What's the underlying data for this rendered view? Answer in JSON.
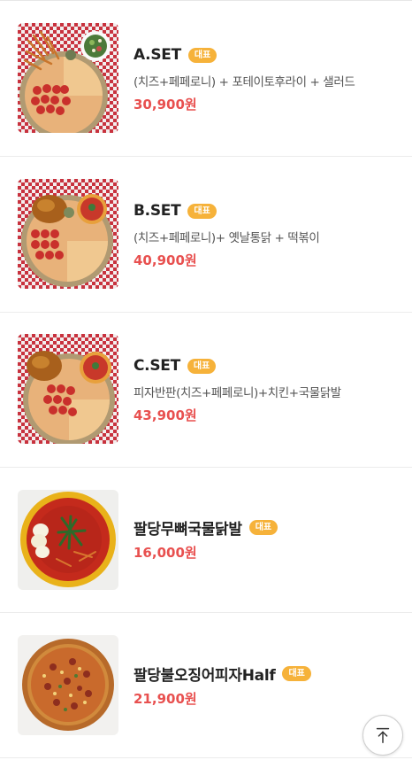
{
  "menu": {
    "items": [
      {
        "name": "A.SET",
        "badge": "대표",
        "description": "(치즈+페페로니) + 포테이토후라이 + 샐러드",
        "price": "30,900원",
        "image": "set-a-photo"
      },
      {
        "name": "B.SET",
        "badge": "대표",
        "description": "(치즈+페페로니)+ 옛날통닭 + 떡볶이",
        "price": "40,900원",
        "image": "set-b-photo"
      },
      {
        "name": "C.SET",
        "badge": "대표",
        "description": "피자반판(치즈+페페로니)+치킨+국물닭발",
        "price": "43,900원",
        "image": "set-c-photo"
      },
      {
        "name": "팔당무뼈국물닭발",
        "badge": "대표",
        "description": "",
        "price": "16,000원",
        "image": "chicken-feet-soup-photo"
      },
      {
        "name": "팔당불오징어피자Half",
        "badge": "대표",
        "description": "",
        "price": "21,900원",
        "image": "squid-pizza-photo"
      }
    ]
  },
  "scroll_top": {
    "icon": "arrow-up-icon"
  },
  "colors": {
    "badge": "#f6b23a",
    "price": "#e8504f",
    "name": "#222222"
  }
}
